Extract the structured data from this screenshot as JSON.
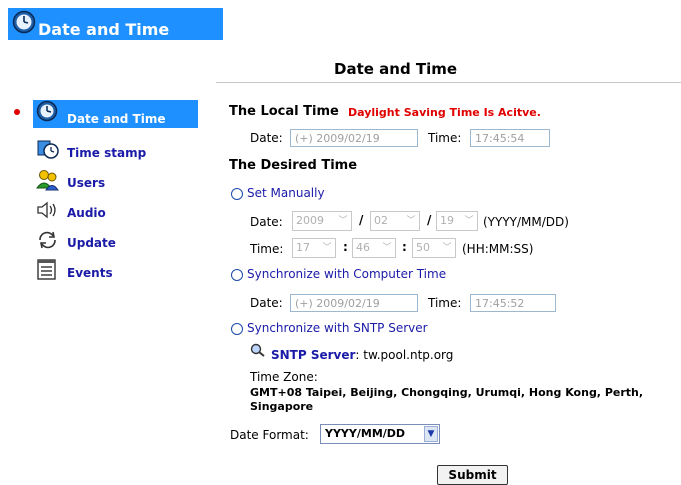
{
  "header": {
    "title": "Date and Time"
  },
  "page": {
    "title": "Date and Time"
  },
  "sidebar": {
    "items": [
      {
        "label": "Date and Time",
        "icon": "clock-icon",
        "active": true
      },
      {
        "label": "Time stamp",
        "icon": "time-stamp-icon"
      },
      {
        "label": "Users",
        "icon": "users-icon"
      },
      {
        "label": "Audio",
        "icon": "speaker-icon"
      },
      {
        "label": "Update",
        "icon": "update-icon"
      },
      {
        "label": "Events",
        "icon": "events-icon"
      }
    ]
  },
  "local_time": {
    "heading": "The Local Time",
    "dst_notice": "Daylight Saving Time Is Acitve.",
    "date_label": "Date:",
    "date_value": "(+) 2009/02/19",
    "time_label": "Time:",
    "time_value": "17:45:54"
  },
  "desired": {
    "heading": "The Desired Time",
    "manual": {
      "label": "Set Manually",
      "date_label": "Date:",
      "year": "2009",
      "month": "02",
      "day": "19",
      "sep": "/",
      "date_hint": "(YYYY/MM/DD)",
      "time_label": "Time:",
      "hour": "17",
      "minute": "46",
      "second": "50",
      "colon": ":",
      "time_hint": "(HH:MM:SS)"
    },
    "computer": {
      "label": "Synchronize with Computer Time",
      "date_label": "Date:",
      "date_value": "(+) 2009/02/19",
      "time_label": "Time:",
      "time_value": "17:45:52"
    },
    "sntp": {
      "label": "Synchronize with SNTP Server",
      "server_label": "SNTP Server",
      "server_value": ": tw.pool.ntp.org",
      "tz_label": "Time Zone:",
      "tz_value_line1": "GMT+08 Taipei, Beijing, Chongqing, Urumqi, Hong Kong, Perth,",
      "tz_value_line2": "Singapore"
    }
  },
  "date_format": {
    "label": "Date Format:",
    "value": "YYYY/MM/DD"
  },
  "submit": {
    "label": "Submit"
  },
  "colors": {
    "accent": "#1e90ff",
    "link": "#1a1aa8",
    "alert": "#e00000"
  }
}
